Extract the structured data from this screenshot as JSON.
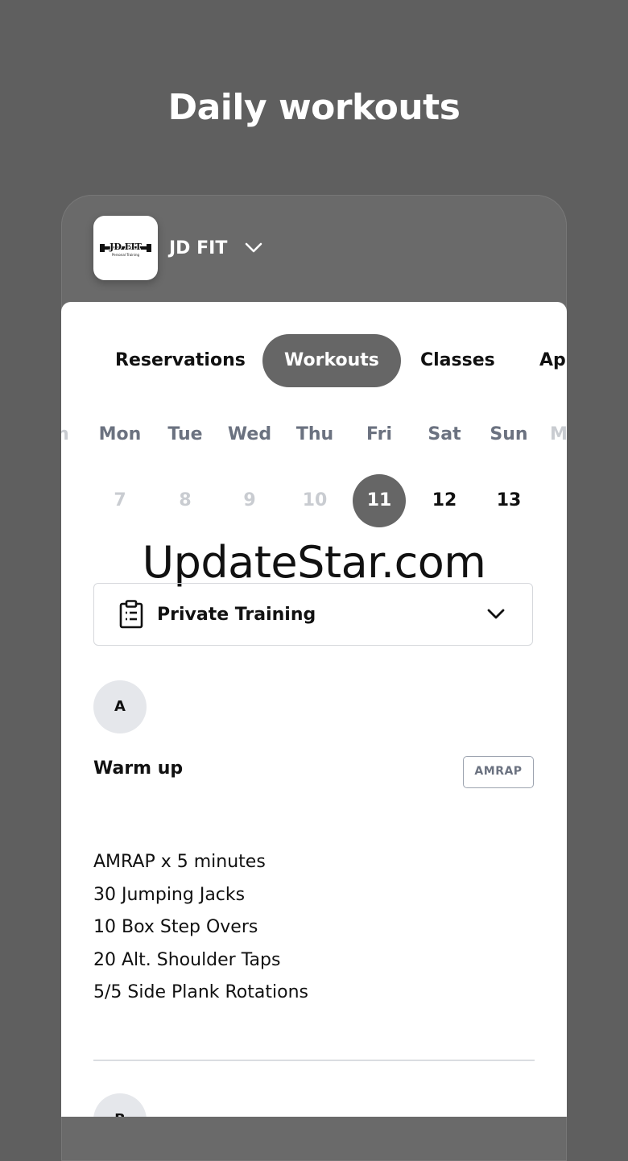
{
  "page": {
    "title": "Daily workouts"
  },
  "gym": {
    "name": "JD FIT",
    "logo_text": "JD FIT",
    "logo_subtext": "Personal Training"
  },
  "tabs": [
    {
      "label": "Reservations",
      "active": false
    },
    {
      "label": "Workouts",
      "active": true
    },
    {
      "label": "Classes",
      "active": false
    },
    {
      "label": "Ap",
      "active": false
    }
  ],
  "week": {
    "days": [
      {
        "name": "n",
        "num": ""
      },
      {
        "name": "Mon",
        "num": "7",
        "state": "past"
      },
      {
        "name": "Tue",
        "num": "8",
        "state": "past"
      },
      {
        "name": "Wed",
        "num": "9",
        "state": "past"
      },
      {
        "name": "Thu",
        "num": "10",
        "state": "past"
      },
      {
        "name": "Fri",
        "num": "11",
        "state": "selected"
      },
      {
        "name": "Sat",
        "num": "12",
        "state": "future"
      },
      {
        "name": "Sun",
        "num": "13",
        "state": "future"
      },
      {
        "name": "M",
        "num": ""
      }
    ]
  },
  "watermark": "UpdateStar.com",
  "program": {
    "label": "Private Training",
    "icon": "clipboard-icon"
  },
  "section": {
    "badge": "A",
    "title": "Warm up",
    "format": "AMRAP",
    "lines": [
      "AMRAP x 5 minutes",
      "30 Jumping Jacks",
      "10 Box Step Overs",
      "20 Alt. Shoulder Taps",
      "5/5 Side Plank Rotations"
    ]
  },
  "next_section": {
    "badge": "B"
  },
  "colors": {
    "background": "#5f5f5f",
    "accent": "#666666",
    "muted": "#6b7280"
  }
}
